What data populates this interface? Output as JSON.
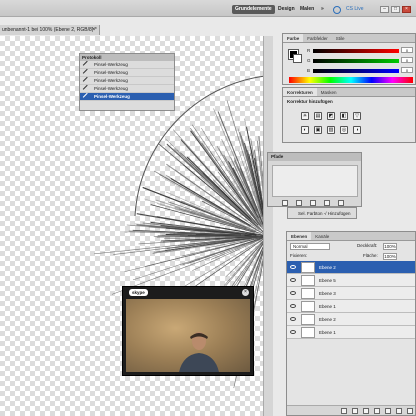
{
  "appbar": {
    "workspace_active": "Grundelemente",
    "workspace_design": "Design",
    "workspace_malen": "Malen",
    "more": "»",
    "cslive": "CS Live",
    "win_min": "–",
    "win_max": "□",
    "win_close": "×"
  },
  "doc": {
    "tab_title": "unbenannt-1 bei 100% (Ebene 2, RGB/8) *",
    "close": "×"
  },
  "history": {
    "title": "Protokoll",
    "items": [
      "Pinsel-Werkzeug",
      "Pinsel-Werkzeug",
      "Pinsel-Werkzeug",
      "Pinsel-Werkzeug",
      "Pinsel-Werkzeug"
    ],
    "selected": "Pinsel-Werkzeug"
  },
  "color": {
    "tabs": [
      "Farbe",
      "Farbfelder",
      "Stile"
    ],
    "r": "0",
    "g": "0",
    "b": "0",
    "r_label": "R",
    "g_label": "G",
    "b_label": "B"
  },
  "adjust": {
    "tabs": [
      "Korrekturen",
      "Masken"
    ],
    "subtitle": "Korrektur hinzufügen",
    "icons": [
      "☀",
      "▤",
      "◩",
      "◧",
      "▽",
      "◐",
      "▣",
      "▨",
      "◎",
      "◑",
      "▦",
      "◪"
    ]
  },
  "masks": {
    "title": "Pfade"
  },
  "paths": {
    "label": "Sel. Farbton -/ Hinzufügen"
  },
  "layers": {
    "tabs": [
      "Ebenen",
      "Kanäle"
    ],
    "blend_mode": "Normal",
    "opacity_label": "Deckkraft:",
    "opacity": "100%",
    "lock_label": "Fixieren:",
    "fill_label": "Fläche:",
    "fill": "100%",
    "items": [
      {
        "name": "Ebene 2",
        "selected": true
      },
      {
        "name": "Ebene 5",
        "selected": false
      },
      {
        "name": "Ebene 3",
        "selected": false
      },
      {
        "name": "Ebene 1",
        "selected": false
      },
      {
        "name": "Ebene 2",
        "selected": false
      },
      {
        "name": "Ebene 1",
        "selected": false
      }
    ]
  },
  "video": {
    "app": "skype",
    "close": "×"
  }
}
